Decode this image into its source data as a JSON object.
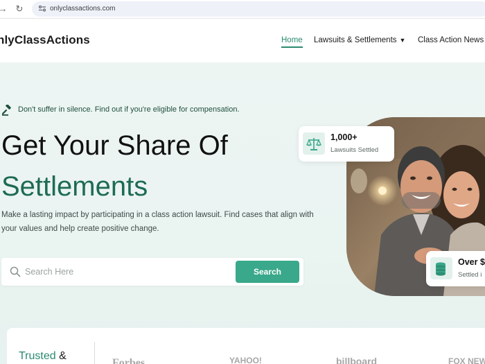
{
  "browser": {
    "back_glyph": "→",
    "reload_glyph": "↻",
    "url": "onlyclassactions.com"
  },
  "header": {
    "logo": "nlyClassActions",
    "nav": [
      {
        "label": "Home"
      },
      {
        "label": "Lawsuits & Settlements"
      },
      {
        "label": "Class Action News"
      }
    ],
    "dropdown_caret": "▼"
  },
  "hero": {
    "tagline": "Don't suffer in silence. Find out if you're eligible for compensation.",
    "headline_line1": "Get Your Share Of",
    "headline_line2": "Settlements",
    "subtext": "Make a lasting impact by participating in a class action lawsuit. Find cases that align with your values and help create positive change.",
    "search": {
      "placeholder": "Search Here",
      "button_label": "Search"
    },
    "stats": [
      {
        "value": "1,000+",
        "label": "Lawsuits Settled",
        "icon": "scales-icon"
      },
      {
        "value": "Over $",
        "label": "Settled i",
        "icon": "coins-icon"
      }
    ]
  },
  "trusted": {
    "label_accent": "Trusted",
    "label_rest": " &",
    "press": [
      "Forbes",
      "YAHOO!",
      "billboard",
      "FOX NEW"
    ]
  },
  "colors": {
    "brand_green": "#2a8a6f",
    "button_green": "#3aa88a",
    "headline_green": "#1e6b55",
    "hero_bg": "#edf5f3"
  }
}
